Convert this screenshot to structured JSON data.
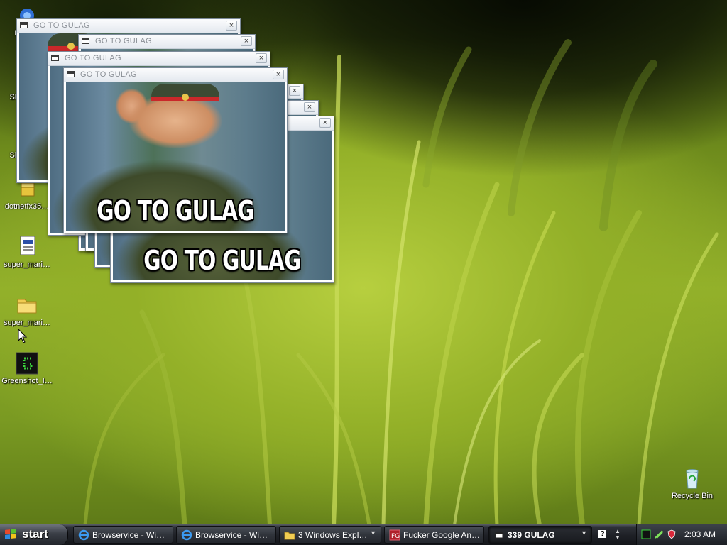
{
  "desktop": {
    "icons": [
      {
        "label": "I… E…",
        "icon": "internet-explorer-icon"
      },
      {
        "label": "Sl… Co…",
        "icon": "shortcut-icon"
      },
      {
        "label": "Sl… Co…",
        "icon": "shortcut-icon"
      },
      {
        "label": "dotnetfx35…",
        "icon": "installer-package-icon"
      },
      {
        "label": "super_mari…",
        "icon": "text-document-icon"
      },
      {
        "label": "super_mari…",
        "icon": "folder-icon"
      },
      {
        "label": "Greenshot_I…",
        "icon": "greenshot-icon"
      },
      {
        "label": "Recycle Bin",
        "icon": "recycle-bin-icon"
      }
    ]
  },
  "popup": {
    "title": "GO TO GULAG",
    "close_glyph": "×",
    "caption": "GO TO GULAG",
    "count_front": 3
  },
  "taskbar": {
    "start_label": "start",
    "buttons": [
      {
        "label": "Browservice - Wi…",
        "icon": "ie-icon"
      },
      {
        "label": "Browservice - Wi…",
        "icon": "ie-icon"
      },
      {
        "label": "3 Windows Expl…",
        "icon": "folder-icon",
        "group_count": "3"
      },
      {
        "label": "Fucker Google An…",
        "icon": "fg-app-icon"
      },
      {
        "label": "339 GULAG",
        "icon": "window-icon",
        "group_count": "339"
      }
    ],
    "clock": "2:03 AM"
  },
  "colors": {
    "grass_light": "#b7cf3f",
    "grass_dark": "#2e3d0d",
    "cap_red": "#c9282a",
    "taskbar": "#1e2026"
  }
}
